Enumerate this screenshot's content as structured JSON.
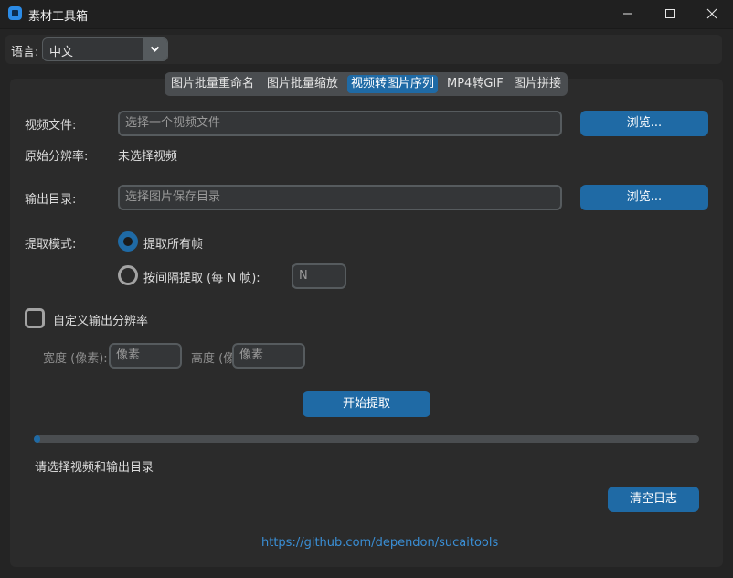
{
  "window": {
    "title": "素材工具箱"
  },
  "language": {
    "label": "语言:",
    "selected": "中文"
  },
  "tabs": [
    {
      "label": "图片批量重命名",
      "active": false
    },
    {
      "label": "图片批量缩放",
      "active": false
    },
    {
      "label": "视频转图片序列",
      "active": true
    },
    {
      "label": "MP4转GIF",
      "active": false
    },
    {
      "label": "图片拼接",
      "active": false
    }
  ],
  "form": {
    "video_label": "视频文件:",
    "video_placeholder": "选择一个视频文件",
    "browse_label": "浏览...",
    "resolution_label": "原始分辨率:",
    "resolution_value": "未选择视频",
    "output_label": "输出目录:",
    "output_placeholder": "选择图片保存目录",
    "mode_label": "提取模式:",
    "mode_all": "提取所有帧",
    "mode_interval": "按间隔提取 (每 N 帧):",
    "interval_placeholder": "N",
    "custom_res_label": "自定义输出分辨率",
    "width_label": "宽度 (像素):",
    "width_placeholder": "像素",
    "height_label": "高度 (像",
    "height_placeholder": "像素",
    "start_label": "开始提取"
  },
  "progress": {
    "value": 0.01
  },
  "status": {
    "text": "请选择视频和输出目录"
  },
  "log": {
    "clear_label": "清空日志"
  },
  "footer": {
    "link": "https://github.com/dependon/sucaitools"
  },
  "colors": {
    "accent": "#1f6aa5",
    "background": "#242424",
    "panel": "#2b2b2b",
    "link": "#3a8fd6"
  }
}
